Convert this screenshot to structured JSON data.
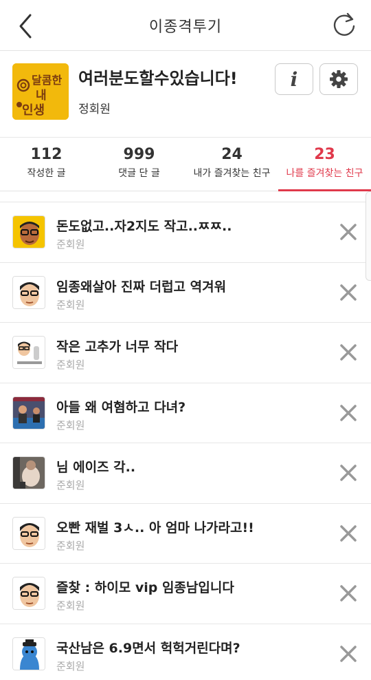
{
  "header": {
    "title": "이종격투기",
    "back_icon": "chevron-left-icon",
    "refresh_icon": "refresh-icon"
  },
  "profile": {
    "name": "여러분도할수있습니다!",
    "grade": "정회원",
    "avatar_text": [
      "달콤한",
      "내",
      "인생"
    ],
    "info_label": "i"
  },
  "stats": [
    {
      "num": "112",
      "label": "작성한 글"
    },
    {
      "num": "999",
      "label": "댓글 단 글"
    },
    {
      "num": "24",
      "label": "내가 즐겨찾는 친구"
    },
    {
      "num": "23",
      "label": "나를 즐겨찾는 친구"
    }
  ],
  "colors": {
    "accent": "#e0394b",
    "avatar_bg": "#f2b90c"
  },
  "friends": [
    {
      "title": "돈도없고..자2지도 작고..ㅉㅉ..",
      "grade": "준회원",
      "avatar": "glasses-face-yellow"
    },
    {
      "title": "임종왜살아 진짜 더럽고 역겨워",
      "grade": "준회원",
      "avatar": "glasses-face"
    },
    {
      "title": "작은 고추가 너무 작다",
      "grade": "준회원",
      "avatar": "glasses-face-small"
    },
    {
      "title": "아들 왜 여혐하고 다녀?",
      "grade": "준회원",
      "avatar": "photo-stage"
    },
    {
      "title": "님 에이즈 각..",
      "grade": "준회원",
      "avatar": "photo-person"
    },
    {
      "title": "오빤 재벌 3ㅅ.. 아 엄마 나가라고!!",
      "grade": "준회원",
      "avatar": "glasses-face"
    },
    {
      "title": "즐찾 : 하이모 vip 임종남입니다",
      "grade": "준회원",
      "avatar": "glasses-face"
    },
    {
      "title": "국산남은 6.9면서 헉헉거린다며?",
      "grade": "준회원",
      "avatar": "blue-character"
    }
  ]
}
